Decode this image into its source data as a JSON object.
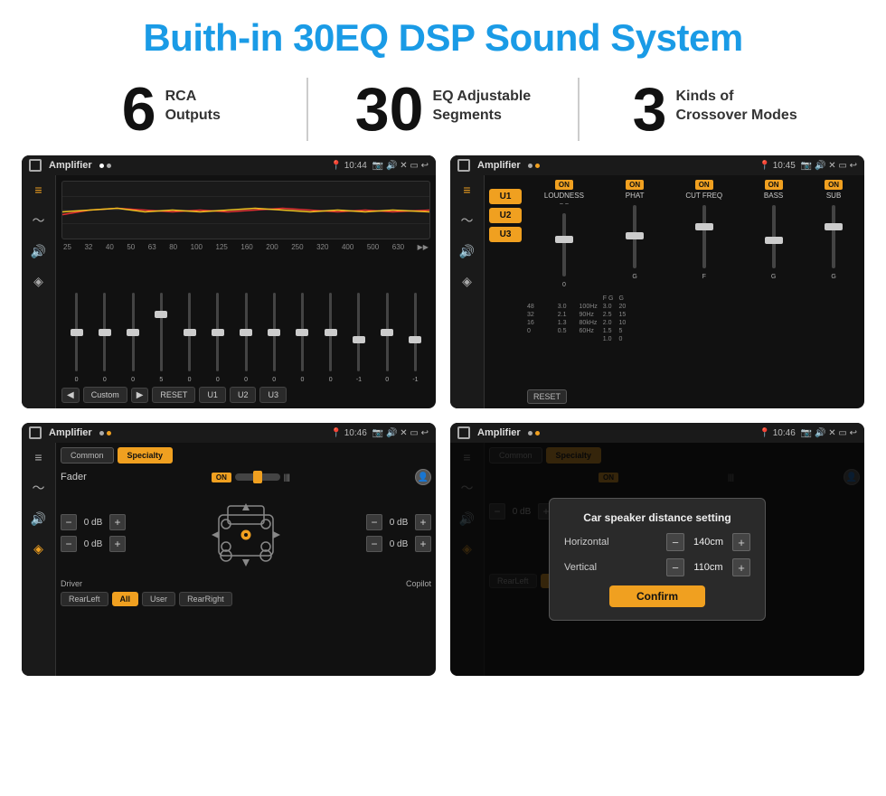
{
  "header": {
    "title": "Buith-in 30EQ DSP Sound System"
  },
  "stats": [
    {
      "number": "6",
      "line1": "RCA",
      "line2": "Outputs"
    },
    {
      "number": "30",
      "line1": "EQ Adjustable",
      "line2": "Segments"
    },
    {
      "number": "3",
      "line1": "Kinds of",
      "line2": "Crossover Modes"
    }
  ],
  "screens": [
    {
      "id": "eq-screen",
      "title": "Amplifier",
      "time": "10:44",
      "type": "eq"
    },
    {
      "id": "amp-screen",
      "title": "Amplifier",
      "time": "10:45",
      "type": "amp"
    },
    {
      "id": "fader-screen",
      "title": "Amplifier",
      "time": "10:46",
      "type": "fader"
    },
    {
      "id": "dialog-screen",
      "title": "Amplifier",
      "time": "10:46",
      "type": "dialog"
    }
  ],
  "eq": {
    "frequencies": [
      "25",
      "32",
      "40",
      "50",
      "63",
      "80",
      "100",
      "125",
      "160",
      "200",
      "250",
      "320",
      "400",
      "500",
      "630"
    ],
    "values": [
      "0",
      "0",
      "0",
      "5",
      "0",
      "0",
      "0",
      "0",
      "0",
      "0",
      "-1",
      "0",
      "-1"
    ],
    "presets": [
      "Custom",
      "RESET",
      "U1",
      "U2",
      "U3"
    ]
  },
  "amp": {
    "presets": [
      "U1",
      "U2",
      "U3"
    ],
    "channels": [
      "LOUDNESS",
      "PHAT",
      "CUT FREQ",
      "BASS",
      "SUB"
    ],
    "resetLabel": "RESET"
  },
  "fader": {
    "tabs": [
      "Common",
      "Specialty"
    ],
    "faderLabel": "Fader",
    "onLabel": "ON",
    "vol1": "0 dB",
    "vol2": "0 dB",
    "vol3": "0 dB",
    "vol4": "0 dB",
    "labels": {
      "driver": "Driver",
      "copilot": "Copilot",
      "rearLeft": "RearLeft",
      "all": "All",
      "user": "User",
      "rearRight": "RearRight"
    }
  },
  "dialog": {
    "title": "Car speaker distance setting",
    "horizontalLabel": "Horizontal",
    "horizontalValue": "140cm",
    "verticalLabel": "Vertical",
    "verticalValue": "110cm",
    "confirmLabel": "Confirm",
    "vol1": "0 dB",
    "vol2": "0 dB"
  }
}
